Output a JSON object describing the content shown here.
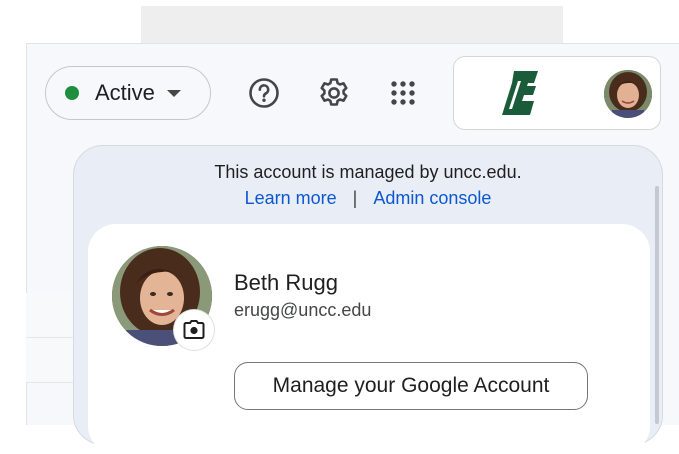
{
  "status": {
    "label": "Active",
    "dot_color": "#1e8e3e"
  },
  "toolbar": {
    "help_icon": "help-circle-icon",
    "settings_icon": "gear-icon",
    "apps_icon": "apps-grid-icon"
  },
  "account": {
    "org_logo": "uncc-logo",
    "brand_color": "#1a5c3a"
  },
  "managed_panel": {
    "message": "This account is managed by uncc.edu.",
    "learn_more": "Learn more",
    "separator": "|",
    "admin_console": "Admin console"
  },
  "user": {
    "name": "Beth Rugg",
    "email": "erugg@uncc.edu",
    "manage_label": "Manage your Google Account",
    "camera_icon": "camera-icon"
  }
}
